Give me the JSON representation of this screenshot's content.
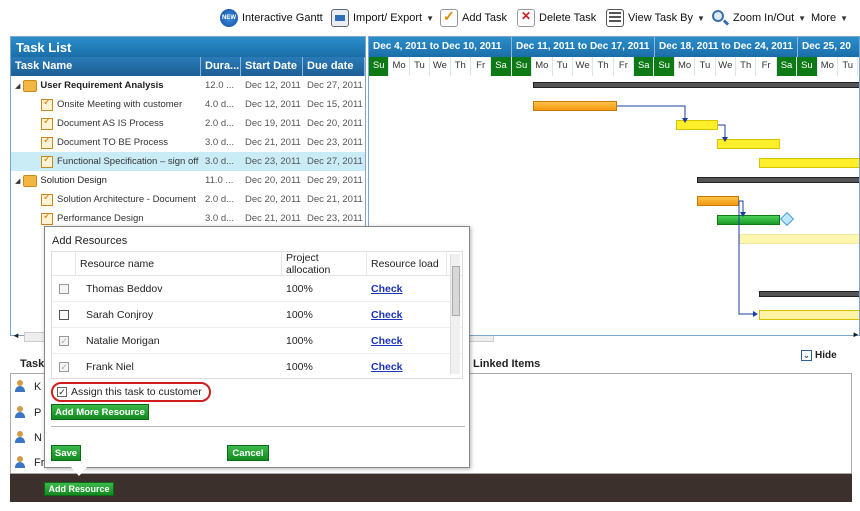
{
  "toolbar": {
    "items": [
      {
        "label": "Interactive Gantt",
        "icon": "new-badge-icon"
      },
      {
        "label": "Import/ Export",
        "icon": "import-export-icon"
      },
      {
        "label": "Add Task",
        "icon": "add-task-icon"
      },
      {
        "label": "Delete Task",
        "icon": "delete-task-icon"
      },
      {
        "label": "View Task By",
        "icon": "view-task-icon"
      },
      {
        "label": "Zoom In/Out",
        "icon": "zoom-icon"
      },
      {
        "label": "More",
        "icon": ""
      }
    ],
    "badge_text": "NEW"
  },
  "task_list": {
    "title": "Task List",
    "headers": [
      "Task Name",
      "Dura...",
      "Start Date",
      "Due date"
    ],
    "rows": [
      {
        "name": "User Requirement Analysis",
        "duration": "12.0 ...",
        "start": "Dec 12, 2011",
        "due": "Dec 27, 2011",
        "level": 0,
        "type": "folder"
      },
      {
        "name": "Onsite Meeting with customer",
        "duration": "4.0 d...",
        "start": "Dec 12, 2011",
        "due": "Dec 15, 2011",
        "level": 1,
        "type": "task"
      },
      {
        "name": "Document AS IS Process",
        "duration": "2.0 d...",
        "start": "Dec 19, 2011",
        "due": "Dec 20, 2011",
        "level": 1,
        "type": "task"
      },
      {
        "name": "Document TO BE Process",
        "duration": "3.0 d...",
        "start": "Dec 21, 2011",
        "due": "Dec 23, 2011",
        "level": 1,
        "type": "task"
      },
      {
        "name": "Functional Specification – sign off",
        "duration": "3.0 d...",
        "start": "Dec 23, 2011",
        "due": "Dec 27, 2011",
        "level": 1,
        "type": "task"
      },
      {
        "name": "Solution Design",
        "duration": "11.0 ...",
        "start": "Dec 20, 2011",
        "due": "Dec 29, 2011",
        "level": 0,
        "type": "folder"
      },
      {
        "name": "Solution Architecture - Document",
        "duration": "2.0 d...",
        "start": "Dec 20, 2011",
        "due": "Dec 21, 2011",
        "level": 1,
        "type": "task"
      },
      {
        "name": "Performance Design",
        "duration": "3.0 d...",
        "start": "Dec 21, 2011",
        "due": "Dec 23, 2011",
        "level": 1,
        "type": "task"
      }
    ]
  },
  "gantt": {
    "weeks": [
      "Dec 4, 2011 to Dec 10, 2011",
      "Dec 11, 2011 to Dec 17, 2011",
      "Dec 18, 2011 to Dec 24, 2011",
      "Dec 25, 20"
    ],
    "days": [
      "Su",
      "Mo",
      "Tu",
      "We",
      "Th",
      "Fr",
      "Sa",
      "Su",
      "Mo",
      "Tu",
      "We",
      "Th",
      "Fr",
      "Sa",
      "Su",
      "Mo",
      "Tu",
      "We",
      "Th",
      "Fr",
      "Sa",
      "Su",
      "Mo",
      "Tu"
    ]
  },
  "details": {
    "task_label": "Task",
    "linked_items": "Linked Items",
    "hide": "Hide",
    "people": [
      "K",
      "P",
      "N",
      "Fr"
    ]
  },
  "dialog": {
    "title": "Add Resources",
    "headers": [
      "Resource name",
      "Project allocation",
      "Resource load"
    ],
    "rows": [
      {
        "name": "Thomas Beddov",
        "allocation": "100%",
        "load": "Check",
        "checked": false
      },
      {
        "name": "Sarah Conjroy",
        "allocation": "100%",
        "load": "Check",
        "checked": false
      },
      {
        "name": "Natalie Morigan",
        "allocation": "100%",
        "load": "Check",
        "checked": true
      },
      {
        "name": "Frank Niel",
        "allocation": "100%",
        "load": "Check",
        "checked": true
      }
    ],
    "assign_label": "Assign this task to customer",
    "add_more": "Add More Resource",
    "save": "Save",
    "cancel": "Cancel"
  },
  "add_resource_button": "Add Resource"
}
